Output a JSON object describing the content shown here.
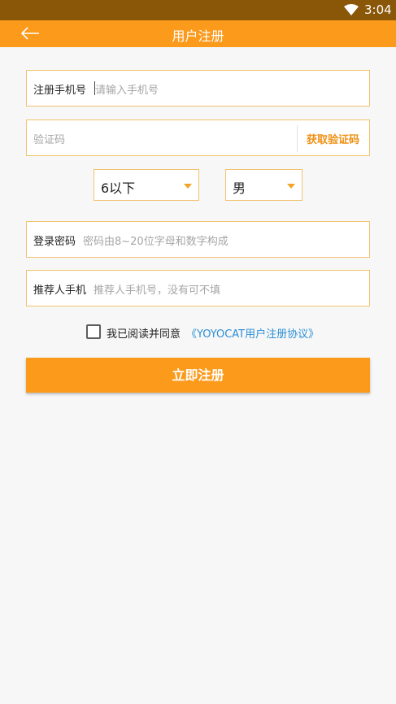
{
  "status_bar": {
    "time": "3:04",
    "wifi_icon": "wifi-icon"
  },
  "app_bar": {
    "title": "用户注册",
    "back_icon": "arrow-left-icon"
  },
  "form": {
    "phone": {
      "label": "注册手机号",
      "placeholder": "请输入手机号"
    },
    "code": {
      "placeholder": "验证码",
      "button_label": "获取验证码"
    },
    "age_select": {
      "value": "6以下"
    },
    "gender_select": {
      "value": "男"
    },
    "password": {
      "label": "登录密码",
      "placeholder": "密码由8~20位字母和数字构成"
    },
    "referrer": {
      "label": "推荐人手机",
      "placeholder": "推荐人手机号，没有可不填"
    },
    "agreement": {
      "text": "我已阅读并同意",
      "link": "《YOYOCAT用户注册协议》",
      "checked": false
    },
    "submit_label": "立即注册"
  },
  "colors": {
    "accent": "#fb9a1b",
    "status_bar": "#8a5608",
    "link": "#2b8fd6",
    "border": "#f1c36f"
  }
}
